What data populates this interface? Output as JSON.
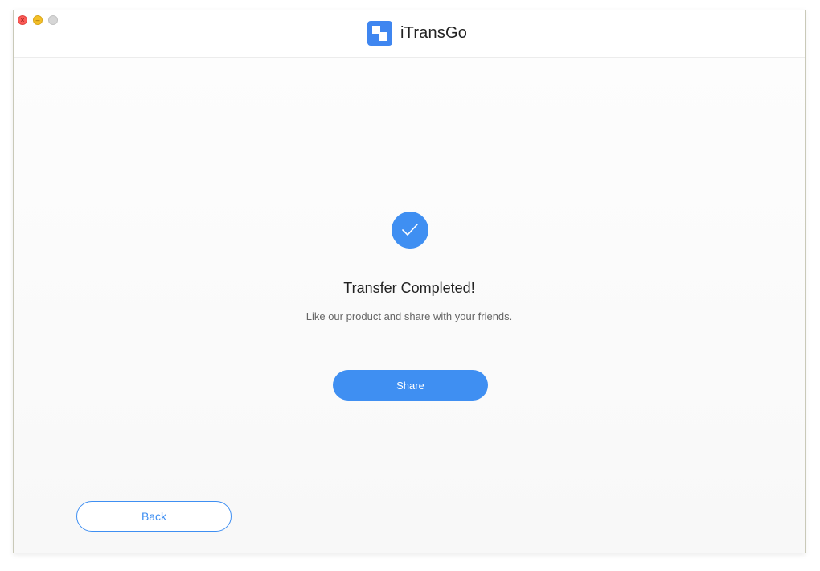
{
  "window": {
    "controls": {
      "close_icon": "close-icon",
      "minimize_icon": "minimize-icon",
      "maximize_icon": "maximize-icon"
    }
  },
  "header": {
    "app_name": "iTransGo",
    "logo_icon": "itransgo-logo-icon"
  },
  "main": {
    "status_icon": "check-circle-icon",
    "title": "Transfer Completed!",
    "subtitle": "Like our product and share with your friends.",
    "share_label": "Share"
  },
  "footer": {
    "back_label": "Back"
  },
  "colors": {
    "accent": "#3f8ff2",
    "title_text": "#222222",
    "subtitle_text": "#666666"
  }
}
